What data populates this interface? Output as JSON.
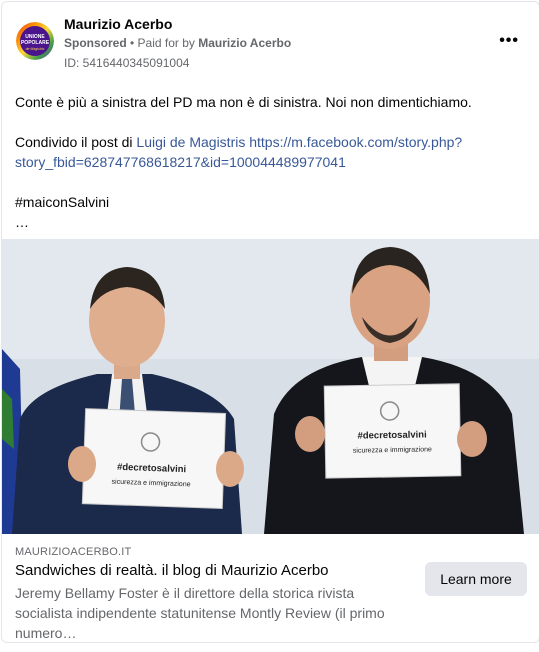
{
  "post": {
    "page_name": "Maurizio Acerbo",
    "sponsored": "Sponsored",
    "paid_for_prefix": " • Paid for by ",
    "paid_for_name": "Maurizio Acerbo",
    "ad_id": "ID: 5416440345091004",
    "more_glyph": "•••",
    "text": {
      "line1": "Conte è più a sinistra del PD ma non è di sinistra. Noi non dimentichiamo.",
      "line2_prefix": "Condivido il post di ",
      "line2_name": "Luigi de Magistris",
      "line2_space": " ",
      "line2_url_part1": "https://m.facebook.com/story.php?",
      "line2_url_part2": "story_fbid=628747768618217&id=100044489977041",
      "hashtag": "#maiconSalvini",
      "ellipsis": "…"
    },
    "avatar": {
      "logo_line1": "UNIONE",
      "logo_line2": "POPOLARE",
      "logo_line3": "de Magistris"
    },
    "photo": {
      "left_sign_hashtag": "#decretosalvini",
      "left_sign_sub": "sicurezza e immigrazione",
      "right_sign_hashtag": "#decretosalvini",
      "right_sign_sub": "sicurezza e immigrazione"
    },
    "link_card": {
      "domain": "MAURIZIOACERBO.IT",
      "title": "Sandwiches di realtà. il blog di Maurizio Acerbo",
      "description": "Jeremy Bellamy Foster è il direttore della storica rivista socialista indipendente statunitense Montly Review (il primo numero…",
      "cta": "Learn more"
    }
  },
  "colors": {
    "link": "#385898",
    "secondary_text": "#65676b",
    "button_bg": "#e4e6eb",
    "photo_bg": "#d7dde5"
  }
}
